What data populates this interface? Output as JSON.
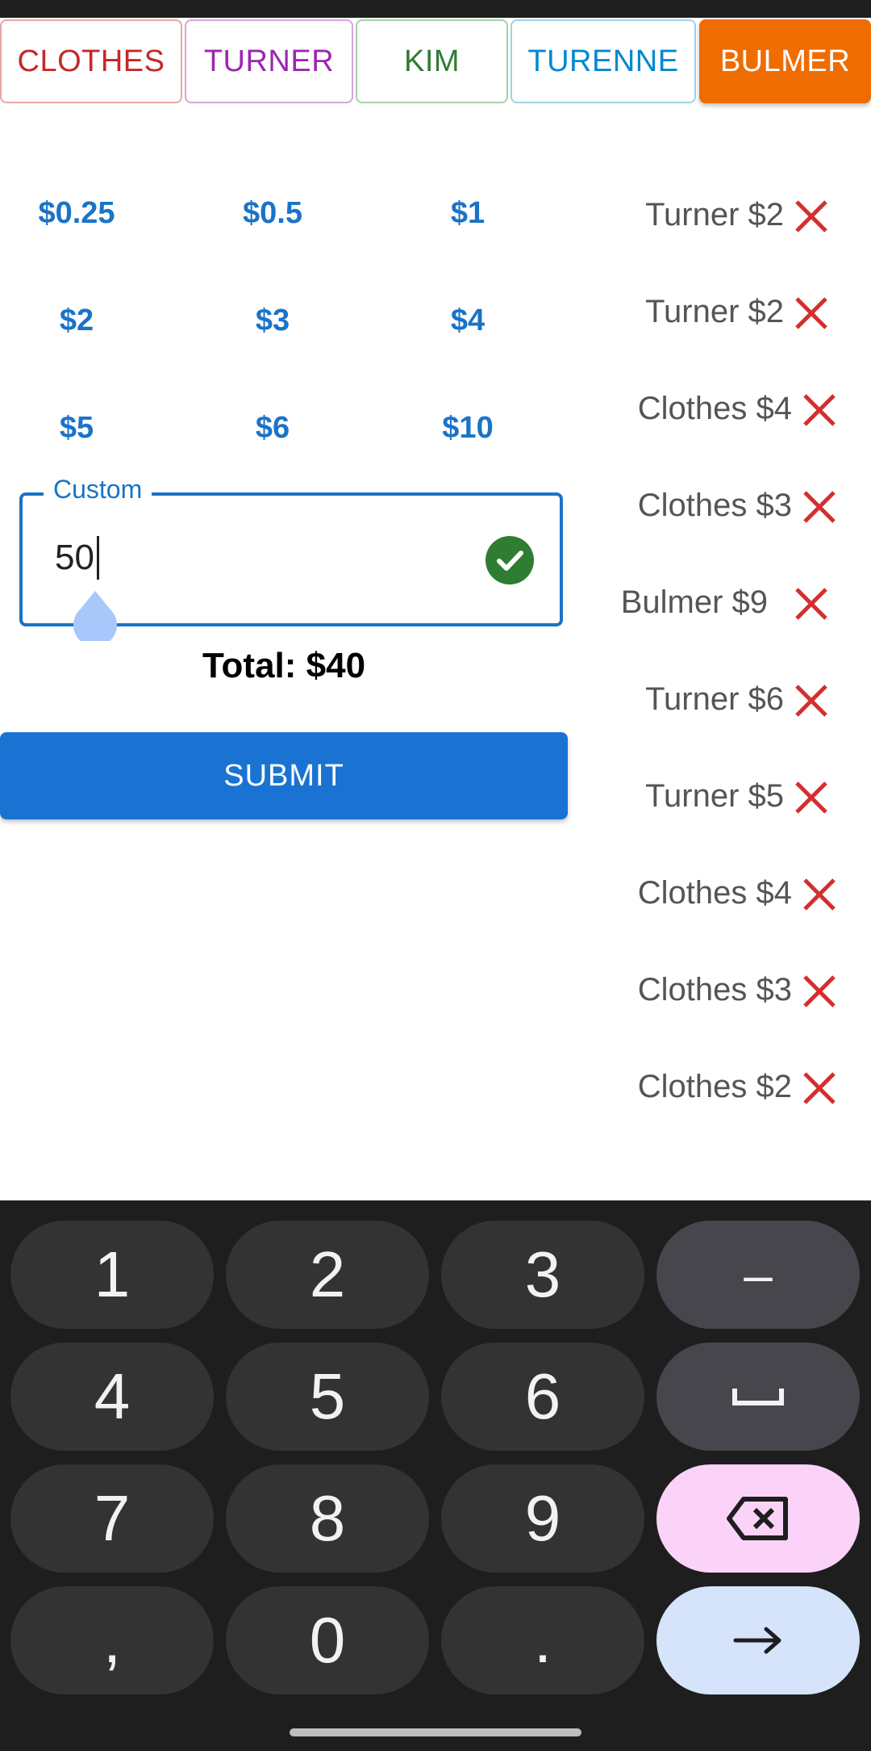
{
  "tabs": [
    {
      "label": "CLOTHES",
      "color": "#c62828",
      "border": "#e9a6a6"
    },
    {
      "label": "TURNER",
      "color": "#9c27b0",
      "border": "#d6a5df"
    },
    {
      "label": "KIM",
      "color": "#2e7d32",
      "border": "#a7cfa9"
    },
    {
      "label": "TURENNE",
      "color": "#0288d1",
      "border": "#9fd2ea"
    },
    {
      "label": "BULMER",
      "color": "#ffffff",
      "background": "#ef6c00",
      "active": true
    }
  ],
  "amounts": [
    "$0.25",
    "$0.5",
    "$1",
    "$2",
    "$3",
    "$4",
    "$5",
    "$6",
    "$10"
  ],
  "custom": {
    "label": "Custom",
    "value": "50"
  },
  "total": "Total: $40",
  "submit_label": "SUBMIT",
  "history": [
    {
      "label": "Turner $2",
      "remove_icon": "close-icon"
    },
    {
      "label": "Turner $2",
      "remove_icon": "close-icon"
    },
    {
      "label": "Clothes $4",
      "remove_icon": "close-icon"
    },
    {
      "label": "Clothes $3",
      "remove_icon": "close-icon"
    },
    {
      "label": "Bulmer $9",
      "remove_icon": "close-icon"
    },
    {
      "label": "Turner $6",
      "remove_icon": "close-icon"
    },
    {
      "label": "Turner $5",
      "remove_icon": "close-icon"
    },
    {
      "label": "Clothes $4",
      "remove_icon": "close-icon"
    },
    {
      "label": "Clothes $3",
      "remove_icon": "close-icon"
    },
    {
      "label": "Clothes $2",
      "remove_icon": "close-icon"
    }
  ],
  "keyboard": {
    "rows": [
      [
        "1",
        "2",
        "3",
        "–"
      ],
      [
        "4",
        "5",
        "6",
        "space-icon"
      ],
      [
        "7",
        "8",
        "9",
        "backspace-icon"
      ],
      [
        ",",
        "0",
        ".",
        "enter-arrow-icon"
      ]
    ]
  },
  "colors": {
    "accent": "#1a73c8",
    "remove": "#d32f2f",
    "check": "#2e7d32"
  }
}
